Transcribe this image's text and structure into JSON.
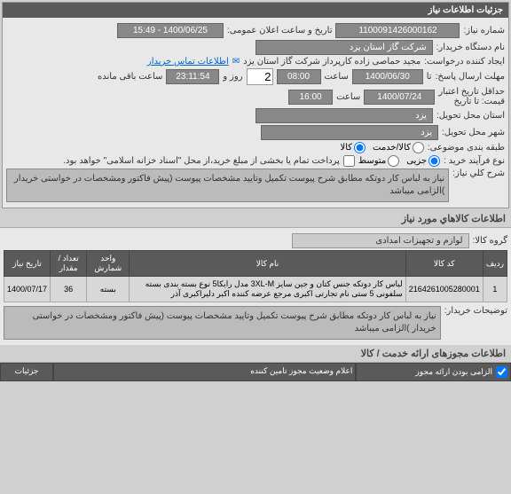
{
  "header": {
    "title": "جزئیات اطلاعات نیاز"
  },
  "fields": {
    "need_no_label": "شماره نیاز:",
    "need_no": "1100091426000162",
    "announce_label": "تاریخ و ساعت اعلان عمومی:",
    "announce_value": "1400/06/25 - 15:49",
    "buyer_org_label": "نام دستگاه خریدار:",
    "buyer_org": "شرکت گاز استان یزد",
    "requester_label": "ایجاد کننده درخواست:",
    "requester": "مجید حماصی زاده کارپرداز شرکت گاز استان یزد",
    "contact_link": "اطلاعات تماس خریدار",
    "deadline_label": "مهلت ارسال پاسخ:",
    "deadline_until": "تا",
    "deadline_date": "1400/06/30",
    "deadline_time_label": "ساعت",
    "deadline_time": "08:00",
    "days_label": "روز و",
    "days": "2",
    "remain_time": "23:11:54",
    "remain_label": "ساعت باقی مانده",
    "valid_label": "حداقل تاریخ اعتبار",
    "valid_label2": "قیمت: تا تاریخ",
    "valid_date": "1400/07/24",
    "valid_time_label": "ساعت",
    "valid_time": "16:00",
    "province_label": "استان محل تحویل:",
    "province": "یزد",
    "city_label": "شهر محل تحویل:",
    "city": "یزد",
    "class_label": "طبقه بندی موضوعی:",
    "class_opt1": "کالا/خدمت",
    "class_opt2": "کالا",
    "buy_process_label": "نوع فرآیند خرید :",
    "buy_process_opt1": "جزیی",
    "buy_process_opt2": "متوسط",
    "buy_process_note": "پرداخت تمام یا بخشی از مبلغ خرید،از محل \"اسناد خزانه اسلامی\" خواهد بود.",
    "desc_label": "شرح کلي نیاز:",
    "desc_text": "نیاز به لباس کار دوتکه مطابق شرح پیوست تکمیل وتایید مشخصات پیوست (پیش فاکتور ومشخصات در خواستی خریدار )الزامی میباشد"
  },
  "goods_section": {
    "title": "اطلاعات كالاهاي مورد نیاز",
    "group_label": "گروه کالا:",
    "group_value": "لوازم و تجهیزات امدادی"
  },
  "table": {
    "headers": {
      "row": "ردیف",
      "code": "کد کالا",
      "name": "نام کالا",
      "unit": "واحد شمارش",
      "qty": "تعداد / مقدار",
      "date": "تاریخ نیاز"
    },
    "rows": [
      {
        "row": "1",
        "code": "2164261005280001",
        "name": "لباس کار دوتکه جنس کتان و جین سایز 3XL-M مدل رایکا5 نوع بسته بندی بسته سلفونی 5 ستی نام تجارتی اکبری مرجع عرضه کننده اکبر دلیراکبری آذر",
        "unit": "بسته",
        "qty": "36",
        "date": "1400/07/17"
      }
    ]
  },
  "notes": {
    "label": "توضیحات خریدار:",
    "text": "نیاز به لباس کار دوتکه مطابق شرح پیوست تکمیل وتایید مشخصات پیوست (پیش فاکتور ومشخصات در خواستی خریدار )الزامی میباشد"
  },
  "licenses": {
    "title": "اطلاعات مجوزهای ارائه خدمت / کالا"
  },
  "bottom": {
    "col1": "الزامی بودن ارائه مجوز",
    "col2": "اعلام وضعیت مجوز تامین کننده",
    "col3": "جزئیات"
  }
}
